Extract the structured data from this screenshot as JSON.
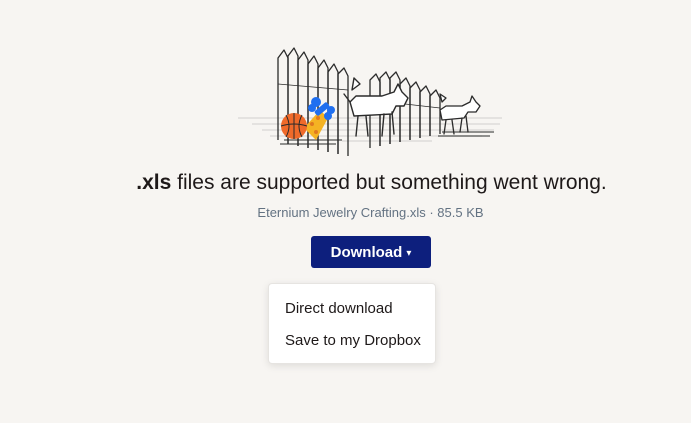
{
  "headline": {
    "extension": ".xls",
    "message": " files are supported but something went wrong."
  },
  "file": {
    "info": "Eternium Jewelry Crafting.xls · 85.5 KB"
  },
  "download": {
    "label": "Download",
    "caret": "▾"
  },
  "dropdown": {
    "items": [
      {
        "label": "Direct download"
      },
      {
        "label": "Save to my Dropbox"
      }
    ]
  },
  "illustration": {
    "icon": "dogs-behind-fence-illustration",
    "colors": {
      "ball": "#f06a2a",
      "bone": "#1f6ff0",
      "toy": "#f5b323",
      "ink": "#2b2b2b"
    }
  },
  "colors": {
    "background": "#f7f5f2",
    "button": "#0d1f7d",
    "text": "#1e1919",
    "muted": "#637282"
  }
}
